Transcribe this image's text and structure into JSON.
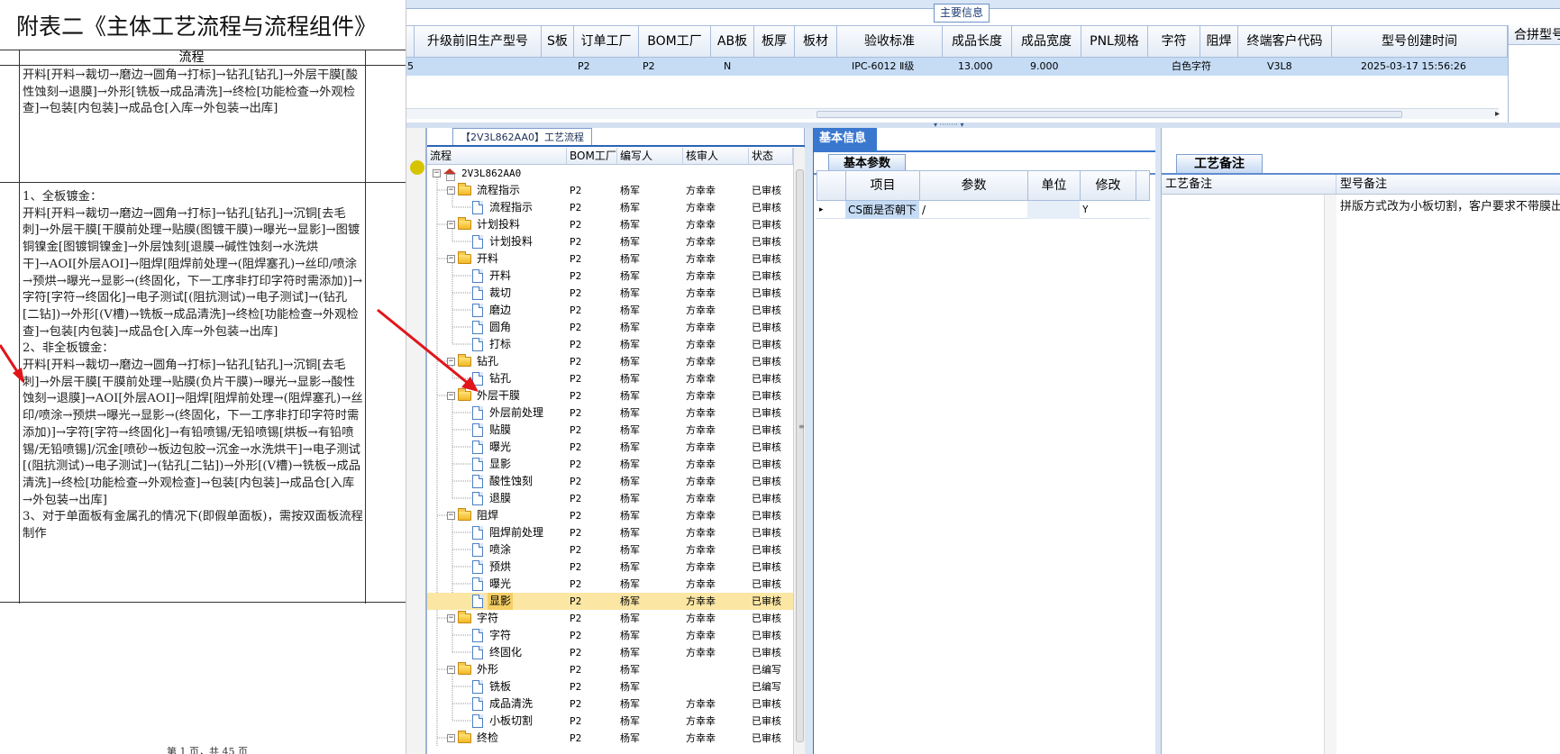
{
  "document": {
    "title": "附表二《主体工艺流程与流程组件》",
    "header_col": "流程",
    "row1": "开料[开料→裁切→磨边→圆角→打标]→钻孔[钻孔]→外层干膜[酸性蚀刻→退膜]→外形[铣板→成品清洗]→终检[功能检查→外观检查]→包装[内包装]→成品仓[入库→外包装→出库]",
    "row2_p1": "1、全板镀金：",
    "row2_p2": "开料[开料→裁切→磨边→圆角→打标]→钻孔[钻孔]→沉铜[去毛刺]→外层干膜[干膜前处理→贴膜(图镀干膜)→曝光→显影]→图镀铜镍金[图镀铜镍金]→外层蚀刻[退膜→碱性蚀刻→水洗烘干]→AOI[外层AOI]→阻焊[阻焊前处理→(阻焊塞孔)→丝印/喷涂→预烘→曝光→显影→(终固化，下一工序非打印字符时需添加)]→字符[字符→终固化]→电子测试[(阻抗测试)→电子测试]→(钻孔[二钻])→外形[(V槽)→铣板→成品清洗]→终检[功能检查→外观检查]→包装[内包装]→成品仓[入库→外包装→出库]",
    "row2_p3": "2、非全板镀金：",
    "row2_p4": "开料[开料→裁切→磨边→圆角→打标]→钻孔[钻孔]→沉铜[去毛刺]→外层干膜[干膜前处理→贴膜(负片干膜)→曝光→显影→酸性蚀刻→退膜]→AOI[外层AOI]→阻焊[阻焊前处理→(阻焊塞孔)→丝印/喷涂→预烘→曝光→显影→(终固化，下一工序非打印字符时需添加)]→字符[字符→终固化]→有铅喷锡/无铅喷锡[烘板→有铅喷锡/无铅喷锡]/沉金[喷砂→板边包胶→沉金→水洗烘干]→电子测试[(阻抗测试)→电子测试]→(钻孔[二钻])→外形[(V槽)→铣板→成品清洗]→终检[功能检查→外观检查]→包装[内包装]→成品仓[入库→外包装→出库]",
    "row2_p5": "3、对于单面板有金属孔的情况下(即假单面板)，需按双面板流程制作",
    "footer": "第 1 页，共 45 页"
  },
  "top_grid": {
    "caption": "主要信息",
    "columns": [
      "升级前旧生产型号",
      "S板",
      "订单工厂",
      "BOM工厂",
      "AB板",
      "板厚",
      "板材",
      "验收标准",
      "成品长度",
      "成品宽度",
      "PNL规格",
      "字符",
      "阻焊",
      "终端客户代码",
      "型号创建时间"
    ],
    "row": {
      "lead": "5",
      "order_factory": "P2",
      "bom_factory": "P2",
      "ab": "N",
      "standard": "IPC-6012 Ⅱ级",
      "length": "13.000",
      "width": "9.000",
      "char": "白色字符",
      "customer": "V3L8",
      "created": "2025-03-17 15:56:26"
    },
    "right_header": "合拼型号",
    "scroll_right": "▸"
  },
  "tree_panel": {
    "tab": "【2V3L862AA0】工艺流程",
    "columns": [
      "流程",
      "BOM工厂",
      "编写人",
      "核审人",
      "状态"
    ],
    "root": "2V3L862AA0",
    "nodes": [
      {
        "name": "流程指示",
        "type": "group",
        "bom": "P2",
        "writer": "杨军",
        "reviewer": "方幸幸",
        "status": "已审核"
      },
      {
        "name": "流程指示",
        "type": "leaf",
        "bom": "P2",
        "writer": "杨军",
        "reviewer": "方幸幸",
        "status": "已审核"
      },
      {
        "name": "计划投料",
        "type": "group",
        "bom": "P2",
        "writer": "杨军",
        "reviewer": "方幸幸",
        "status": "已审核"
      },
      {
        "name": "计划投料",
        "type": "leaf",
        "bom": "P2",
        "writer": "杨军",
        "reviewer": "方幸幸",
        "status": "已审核"
      },
      {
        "name": "开料",
        "type": "group",
        "bom": "P2",
        "writer": "杨军",
        "reviewer": "方幸幸",
        "status": "已审核"
      },
      {
        "name": "开料",
        "type": "leaf",
        "bom": "P2",
        "writer": "杨军",
        "reviewer": "方幸幸",
        "status": "已审核"
      },
      {
        "name": "裁切",
        "type": "leaf",
        "bom": "P2",
        "writer": "杨军",
        "reviewer": "方幸幸",
        "status": "已审核"
      },
      {
        "name": "磨边",
        "type": "leaf",
        "bom": "P2",
        "writer": "杨军",
        "reviewer": "方幸幸",
        "status": "已审核"
      },
      {
        "name": "圆角",
        "type": "leaf",
        "bom": "P2",
        "writer": "杨军",
        "reviewer": "方幸幸",
        "status": "已审核"
      },
      {
        "name": "打标",
        "type": "leaf",
        "bom": "P2",
        "writer": "杨军",
        "reviewer": "方幸幸",
        "status": "已审核"
      },
      {
        "name": "钻孔",
        "type": "group",
        "bom": "P2",
        "writer": "杨军",
        "reviewer": "方幸幸",
        "status": "已审核"
      },
      {
        "name": "钻孔",
        "type": "leaf",
        "bom": "P2",
        "writer": "杨军",
        "reviewer": "方幸幸",
        "status": "已审核"
      },
      {
        "name": "外层干膜",
        "type": "group",
        "bom": "P2",
        "writer": "杨军",
        "reviewer": "方幸幸",
        "status": "已审核"
      },
      {
        "name": "外层前处理",
        "type": "leaf",
        "bom": "P2",
        "writer": "杨军",
        "reviewer": "方幸幸",
        "status": "已审核"
      },
      {
        "name": "贴膜",
        "type": "leaf",
        "bom": "P2",
        "writer": "杨军",
        "reviewer": "方幸幸",
        "status": "已审核"
      },
      {
        "name": "曝光",
        "type": "leaf",
        "bom": "P2",
        "writer": "杨军",
        "reviewer": "方幸幸",
        "status": "已审核"
      },
      {
        "name": "显影",
        "type": "leaf",
        "bom": "P2",
        "writer": "杨军",
        "reviewer": "方幸幸",
        "status": "已审核"
      },
      {
        "name": "酸性蚀刻",
        "type": "leaf",
        "bom": "P2",
        "writer": "杨军",
        "reviewer": "方幸幸",
        "status": "已审核"
      },
      {
        "name": "退膜",
        "type": "leaf",
        "bom": "P2",
        "writer": "杨军",
        "reviewer": "方幸幸",
        "status": "已审核"
      },
      {
        "name": "阻焊",
        "type": "group",
        "bom": "P2",
        "writer": "杨军",
        "reviewer": "方幸幸",
        "status": "已审核"
      },
      {
        "name": "阻焊前处理",
        "type": "leaf",
        "bom": "P2",
        "writer": "杨军",
        "reviewer": "方幸幸",
        "status": "已审核"
      },
      {
        "name": "喷涂",
        "type": "leaf",
        "bom": "P2",
        "writer": "杨军",
        "reviewer": "方幸幸",
        "status": "已审核"
      },
      {
        "name": "预烘",
        "type": "leaf",
        "bom": "P2",
        "writer": "杨军",
        "reviewer": "方幸幸",
        "status": "已审核"
      },
      {
        "name": "曝光",
        "type": "leaf",
        "bom": "P2",
        "writer": "杨军",
        "reviewer": "方幸幸",
        "status": "已审核"
      },
      {
        "name": "显影",
        "type": "leaf",
        "bom": "P2",
        "writer": "杨军",
        "reviewer": "方幸幸",
        "status": "已审核",
        "selected": true
      },
      {
        "name": "字符",
        "type": "group",
        "bom": "P2",
        "writer": "杨军",
        "reviewer": "方幸幸",
        "status": "已审核"
      },
      {
        "name": "字符",
        "type": "leaf",
        "bom": "P2",
        "writer": "杨军",
        "reviewer": "方幸幸",
        "status": "已审核"
      },
      {
        "name": "终固化",
        "type": "leaf",
        "bom": "P2",
        "writer": "杨军",
        "reviewer": "方幸幸",
        "status": "已审核"
      },
      {
        "name": "外形",
        "type": "group",
        "bom": "P2",
        "writer": "杨军",
        "reviewer": "",
        "status": "已编写"
      },
      {
        "name": "铣板",
        "type": "leaf",
        "bom": "P2",
        "writer": "杨军",
        "reviewer": "",
        "status": "已编写"
      },
      {
        "name": "成品清洗",
        "type": "leaf",
        "bom": "P2",
        "writer": "杨军",
        "reviewer": "方幸幸",
        "status": "已审核"
      },
      {
        "name": "小板切割",
        "type": "leaf",
        "bom": "P2",
        "writer": "杨军",
        "reviewer": "方幸幸",
        "status": "已审核"
      },
      {
        "name": "终检",
        "type": "group",
        "bom": "P2",
        "writer": "杨军",
        "reviewer": "方幸幸",
        "status": "已审核"
      }
    ]
  },
  "basic_panel": {
    "tab": "基本信息",
    "subtab": "基本参数",
    "columns": [
      "项目",
      "参数",
      "单位",
      "修改"
    ],
    "row": {
      "item": "CS面是否朝下",
      "param": "/",
      "unit": "",
      "modify": "Y",
      "indicator": "▸"
    }
  },
  "remarks_panel": {
    "tab": "工艺备注",
    "columns": [
      "工艺备注",
      "型号备注"
    ],
    "text": "拼版方式改为小板切割，客户要求不带膜出货"
  },
  "colors": {
    "accent_blue": "#3a78cf",
    "selection_row": "#c6dcf5",
    "tree_selected": "#f5cf66",
    "arrow": "#e0151a"
  }
}
